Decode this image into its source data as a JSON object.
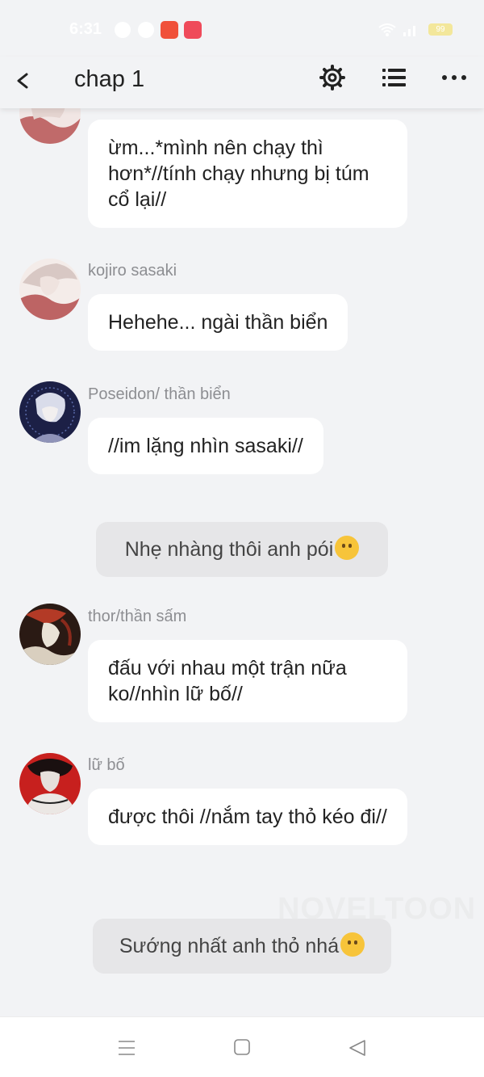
{
  "status": {
    "time": "6:31",
    "battery": "99"
  },
  "header": {
    "title": "chap 1",
    "icons": [
      "back-arrow-icon",
      "gear-icon",
      "list-icon",
      "more-dots-icon"
    ]
  },
  "messages": [
    {
      "sender": "",
      "text": "ừm...*mình nên chạy thì hơn*//tính chạy nhưng bị túm cổ lại//"
    },
    {
      "sender": "kojiro sasaki",
      "text": "Hehehe... ngài thần biển"
    },
    {
      "sender": "Poseidon/ thần biển",
      "text": "//im lặng nhìn sasaki//"
    },
    {
      "narration": "Nhẹ nhàng thôi anh pói",
      "emoji": "slightly-smiling-face"
    },
    {
      "sender": "thor/thần sấm",
      "text": "đấu với nhau một trận nữa ko//nhìn lữ bố//"
    },
    {
      "sender": "lữ bố",
      "text": "được thôi //nắm tay thỏ kéo đi//"
    },
    {
      "narration": "Sướng nhất anh thỏ nhá",
      "emoji": "smirking-face"
    }
  ],
  "watermark": "NOVELTOON",
  "colors": {
    "background": "#f2f3f5",
    "bubble": "#ffffff",
    "narration": "#e6e6e8",
    "name": "#8d8e92"
  }
}
